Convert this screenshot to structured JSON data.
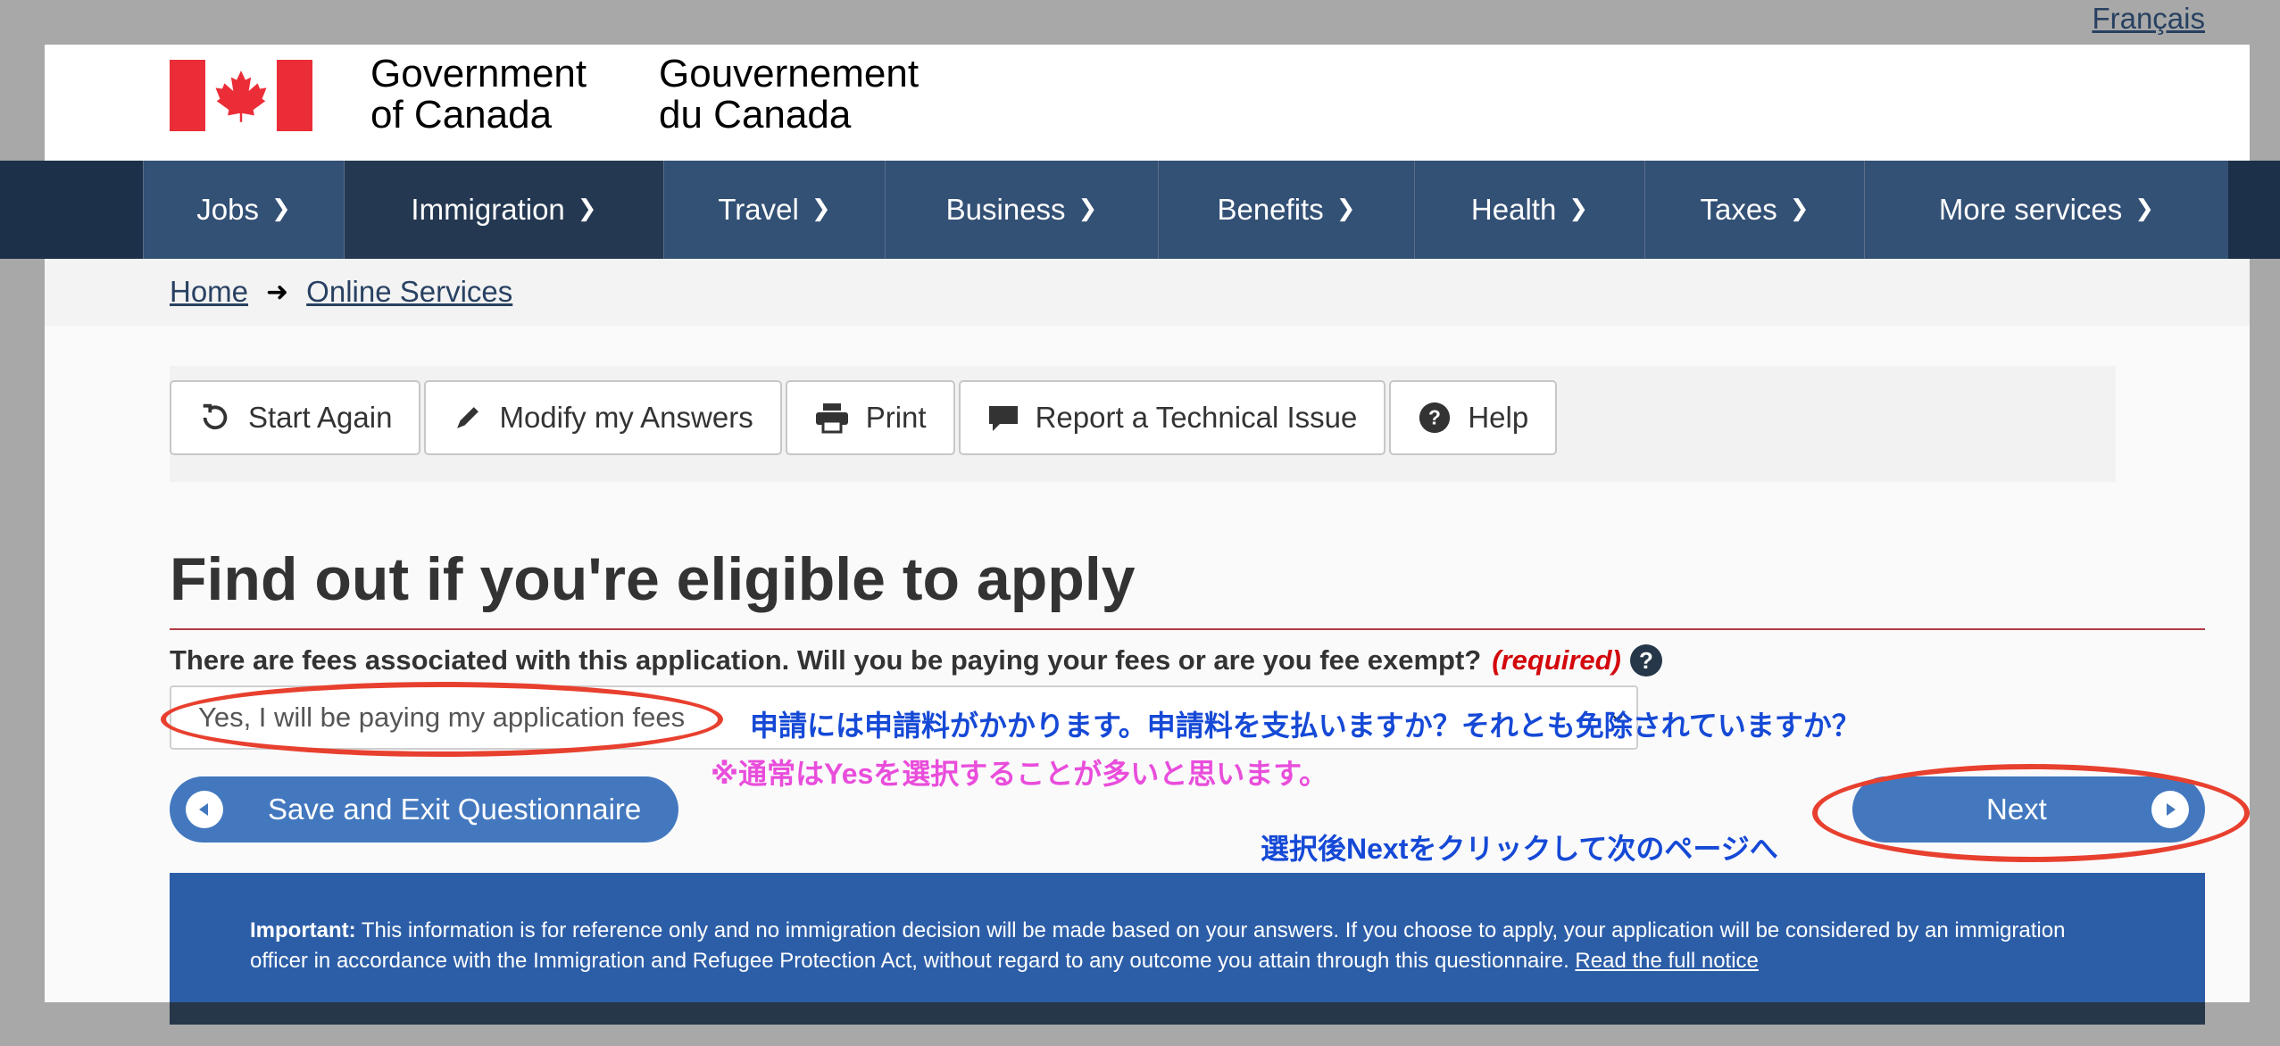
{
  "header": {
    "language_link": "Français",
    "signature_en": [
      "Government",
      "of Canada"
    ],
    "signature_fr": [
      "Gouvernement",
      "du Canada"
    ]
  },
  "nav": {
    "items": [
      {
        "label": "Jobs"
      },
      {
        "label": "Immigration"
      },
      {
        "label": "Travel"
      },
      {
        "label": "Business"
      },
      {
        "label": "Benefits"
      },
      {
        "label": "Health"
      },
      {
        "label": "Taxes"
      },
      {
        "label": "More services"
      }
    ]
  },
  "breadcrumb": {
    "home": "Home",
    "current": "Online Services"
  },
  "toolbar": {
    "start_again": "Start Again",
    "modify": "Modify my Answers",
    "print": "Print",
    "report": "Report a Technical Issue",
    "help": "Help"
  },
  "main": {
    "title": "Find out if you're eligible to apply",
    "question": "There are fees associated with this application. Will you be paying your fees or are you fee exempt?",
    "required": "(required)",
    "help_glyph": "?",
    "select_value": "Yes, I will be paying my application fees",
    "save_exit": "Save and Exit Questionnaire",
    "next": "Next"
  },
  "annotations": {
    "translation": "申請には申請料がかかります。申請料を支払いますか？それとも免除されていますか？",
    "hint": "※通常はYesを選択することが多いと思います。",
    "next_hint": "選択後Nextをクリックして次のページへ"
  },
  "notice": {
    "label": "Important:",
    "text": " This information is for reference only and no immigration decision will be made based on your answers. If you choose to apply, your application will be considered by an immigration officer in accordance with the Immigration and Refugee Protection Act, without regard to any outcome you attain through this questionnaire. ",
    "link": "Read the full notice"
  },
  "colors": {
    "nav_bg": "#335075",
    "nav_active": "#243852",
    "button_blue": "#4378bf",
    "notice_blue": "#2c5ea8",
    "annotation_red": "#e8402f",
    "annotation_blue": "#1549d6",
    "annotation_pink": "#e94ddb",
    "required_red": "#d3080c"
  },
  "icons": [
    "refresh-icon",
    "pencil-icon",
    "printer-icon",
    "comment-icon",
    "question-circle-icon",
    "chevron-down-icon",
    "arrow-right-icon",
    "arrow-left-circle-icon",
    "arrow-right-circle-icon",
    "maple-leaf-icon"
  ]
}
